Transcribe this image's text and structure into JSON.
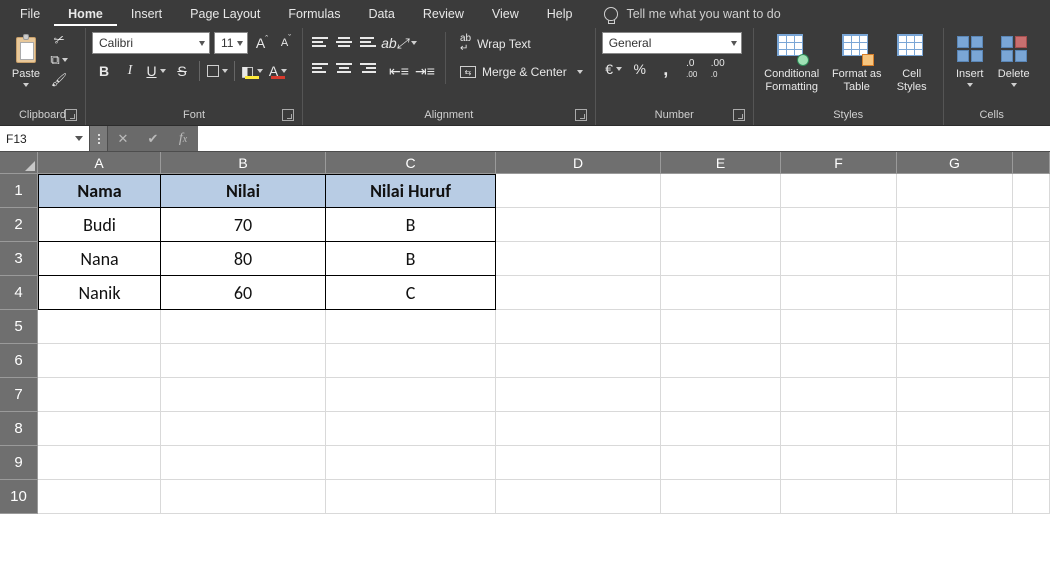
{
  "menu": {
    "tabs": [
      "File",
      "Home",
      "Insert",
      "Page Layout",
      "Formulas",
      "Data",
      "Review",
      "View",
      "Help"
    ],
    "active": "Home",
    "search_hint": "Tell me what you want to do"
  },
  "ribbon": {
    "clipboard": {
      "label": "Clipboard",
      "paste": "Paste"
    },
    "font": {
      "label": "Font",
      "name": "Calibri",
      "size": "11"
    },
    "alignment": {
      "label": "Alignment",
      "wrap": "Wrap Text",
      "merge": "Merge & Center"
    },
    "number": {
      "label": "Number",
      "format": "General",
      "currency": "€",
      "percent": "%",
      "comma": ",",
      "inc_dec_left": ".0₀",
      "inc_dec_right": ".0₀"
    },
    "styles": {
      "label": "Styles",
      "conditional": "Conditional\nFormatting",
      "formatas": "Format as\nTable",
      "cellstyles": "Cell\nStyles"
    },
    "cells": {
      "label": "Cells",
      "insert": "Insert",
      "delete": "Delete"
    }
  },
  "namebox": "F13",
  "formula": "",
  "columns": [
    "A",
    "B",
    "C",
    "D",
    "E",
    "F",
    "G"
  ],
  "row_numbers": [
    1,
    2,
    3,
    4,
    5,
    6,
    7,
    8,
    9,
    10
  ],
  "table": {
    "headers": {
      "A": "Nama",
      "B": "Nilai",
      "C": "Nilai Huruf"
    },
    "rows": [
      {
        "A": "Budi",
        "B": "70",
        "C": "B"
      },
      {
        "A": "Nana",
        "B": "80",
        "C": "B"
      },
      {
        "A": "Nanik",
        "B": "60",
        "C": "C"
      }
    ]
  }
}
